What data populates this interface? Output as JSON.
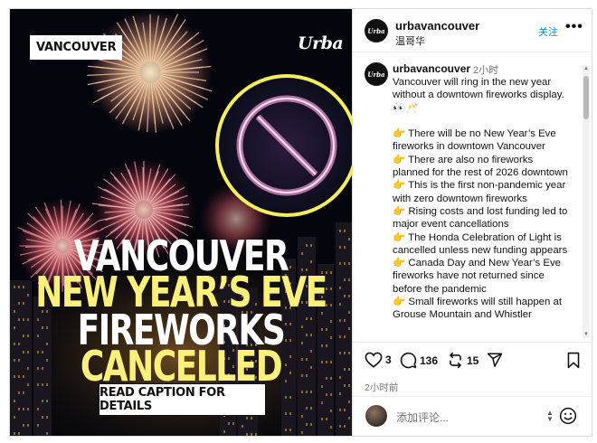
{
  "post": {
    "image": {
      "tag": "VANCOUVER",
      "brand": "Urba",
      "headline": [
        "VANCOUVER",
        "NEW YEAR’S EVE",
        "FIREWORKS",
        "CANCELLED"
      ],
      "cta": "READ CAPTION FOR DETAILS",
      "colors": {
        "background": "#05060d",
        "highlight": "#fbf07a",
        "ring": "#f4ee5c"
      }
    },
    "header": {
      "account": "urbavancouver",
      "location": "温哥华",
      "follow_label": "关注",
      "more_label": "•••"
    },
    "caption": {
      "account": "urbavancouver",
      "time": "2小时",
      "body": "Vancouver will ring in the new year without a downtown fireworks display. 👀🥂\n\n👉 There will be no New Year’s Eve fireworks in downtown Vancouver\n👉 There are also no fireworks planned for the rest of 2026 downtown\n👉 This is the first non-pandemic year with zero downtown fireworks\n👉 Rising costs and lost funding led to major event cancellations\n👉 The Honda Celebration of Light is cancelled unless new funding appears\n👉 Canada Day and New Year’s Eve fireworks have not returned since before the pandemic\n👉 Small fireworks will still happen at Grouse Mountain and Whistler"
    },
    "actions": {
      "likes": "3",
      "comments": "136",
      "shares": "15",
      "posted": "2小时前",
      "icons": [
        "heart-icon",
        "comment-icon",
        "repost-icon",
        "send-icon",
        "bookmark-icon"
      ]
    },
    "composer": {
      "placeholder": "添加评论...",
      "emoji_icon": "smiley-icon"
    }
  }
}
